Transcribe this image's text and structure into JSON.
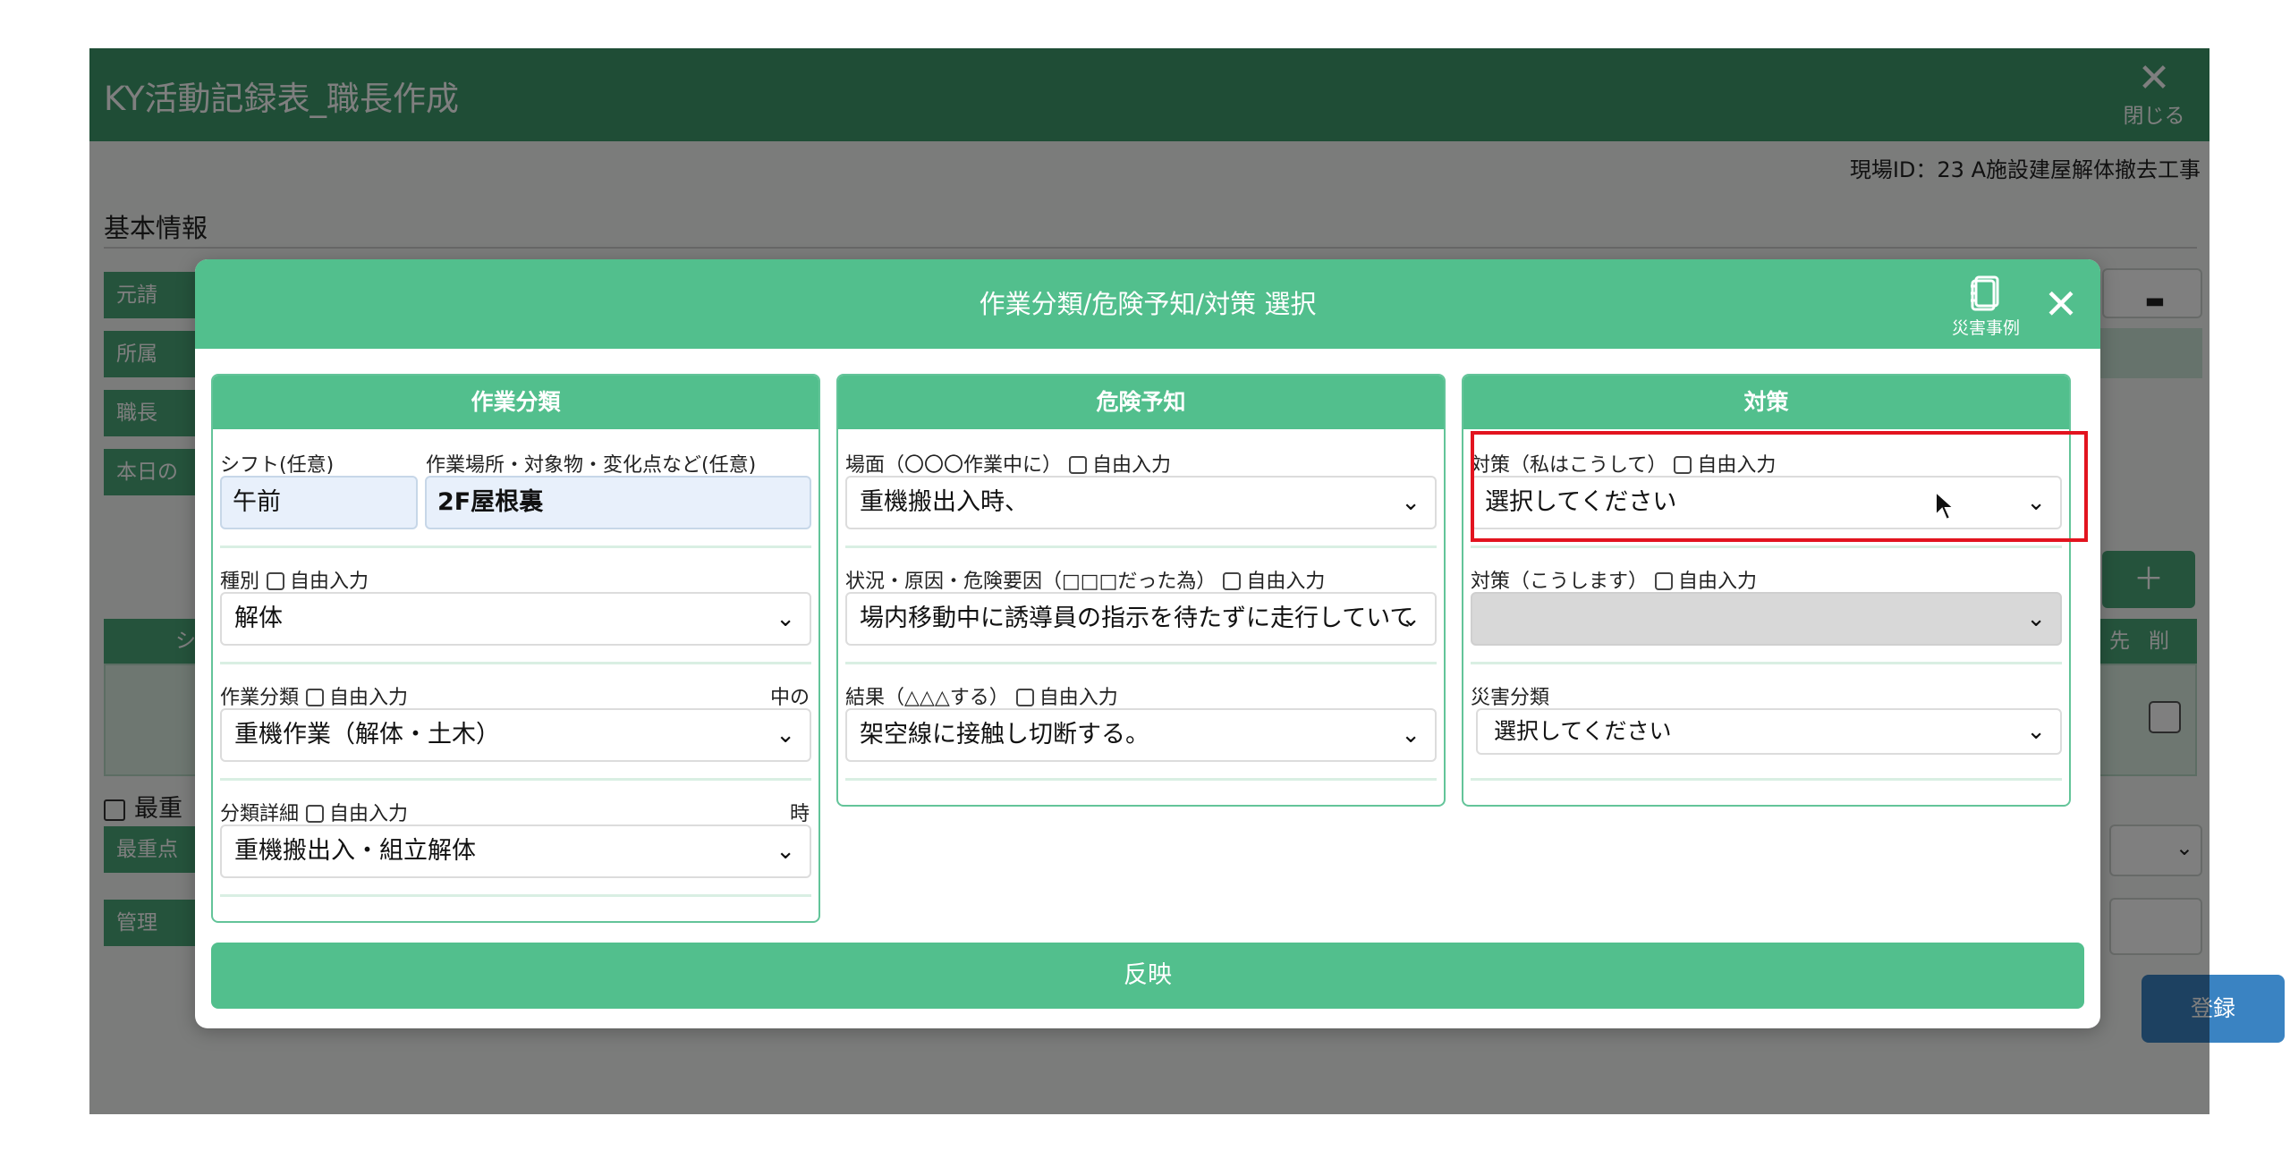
{
  "app": {
    "title": "KY活動記録表_職長作成",
    "close_label": "閉じる",
    "site_id": "現場ID：23 A施設建屋解体撤去工事",
    "section_basic": "基本情報",
    "partial_labels": [
      "元請",
      "所属",
      "職長",
      "本日の"
    ],
    "col_partial": "シ",
    "col_dest": "先",
    "col_delete": "削",
    "saijuu_partial": "最重",
    "saijuu_field_partial": "最重点",
    "kanri_partial": "管理",
    "register_label": "登録",
    "plus_symbol": "＋"
  },
  "modal": {
    "title": "作業分類/危険予知/対策 選択",
    "saigai_label": "災害事例",
    "apply_label": "反映",
    "work": {
      "header": "作業分類",
      "shift_label": "シフト(任意)",
      "shift_value": "午前",
      "place_label": "作業場所・対象物・変化点など(任意)",
      "place_value": "2F屋根裏",
      "type_label": "種別",
      "type_value": "解体",
      "class_label": "作業分類",
      "class_right": "中の",
      "class_value": "重機作業（解体・土木）",
      "detail_label": "分類詳細",
      "detail_right": "時",
      "detail_value": "重機搬出入・組立解体"
    },
    "hazard": {
      "header": "危険予知",
      "scene_label": "場面（〇〇〇作業中に）",
      "scene_value": "重機搬出入時、",
      "cause_label": "状況・原因・危険要因（□□□だった為）",
      "cause_value": "場内移動中に誘導員の指示を待たずに走行していて",
      "result_label": "結果（△△△する）",
      "result_value": "架空線に接触し切断する。"
    },
    "measure": {
      "header": "対策",
      "mine_label": "対策（私はこうして）",
      "mine_value": "選択してください",
      "will_label": "対策（こうします）",
      "will_value": "",
      "disaster_label": "災害分類",
      "disaster_value": "選択してください"
    },
    "free_input": "自由入力"
  }
}
